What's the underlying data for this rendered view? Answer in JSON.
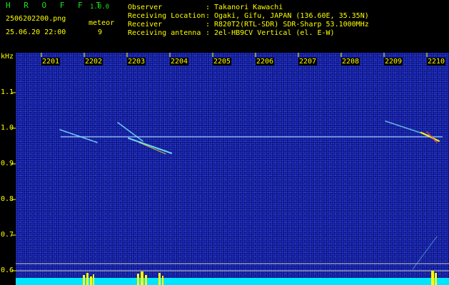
{
  "header": {
    "app_title": "H R O F F T",
    "app_version": "1.0.0",
    "filename": "2506202200.png",
    "datetime": "25.06.20 22:00",
    "count_label": "meteor",
    "count_value": "9",
    "info": [
      {
        "label": "Observer",
        "value": "Takanori Kawachi"
      },
      {
        "label": "Receiving Location",
        "value": "Ogaki, Gifu, JAPAN (136.60E, 35.35N)"
      },
      {
        "label": "Receiver",
        "value": "R820T2(RTL-SDR) SDR-Sharp 53.1000MHz"
      },
      {
        "label": "Receiving antenna",
        "value": "2el-HB9CV Vertical (el. E-W)"
      }
    ],
    "separator": ":"
  },
  "axis": {
    "unit": "kHz",
    "time_ticks": [
      "2201",
      "2202",
      "2203",
      "2204",
      "2205",
      "2206",
      "2207",
      "2208",
      "2209",
      "2210"
    ],
    "freq_ticks": [
      "1.1",
      "1.0",
      "0.9",
      "0.8",
      "0.7",
      "0.6"
    ]
  },
  "colors": {
    "label": "#ffff00",
    "title": "#19e619",
    "background": "#0d1282",
    "carrier": "#9fd0ff",
    "echo": "#7ff0ff",
    "echo_hot": "#ffff00",
    "signal_strip": "#00e5ff"
  }
}
